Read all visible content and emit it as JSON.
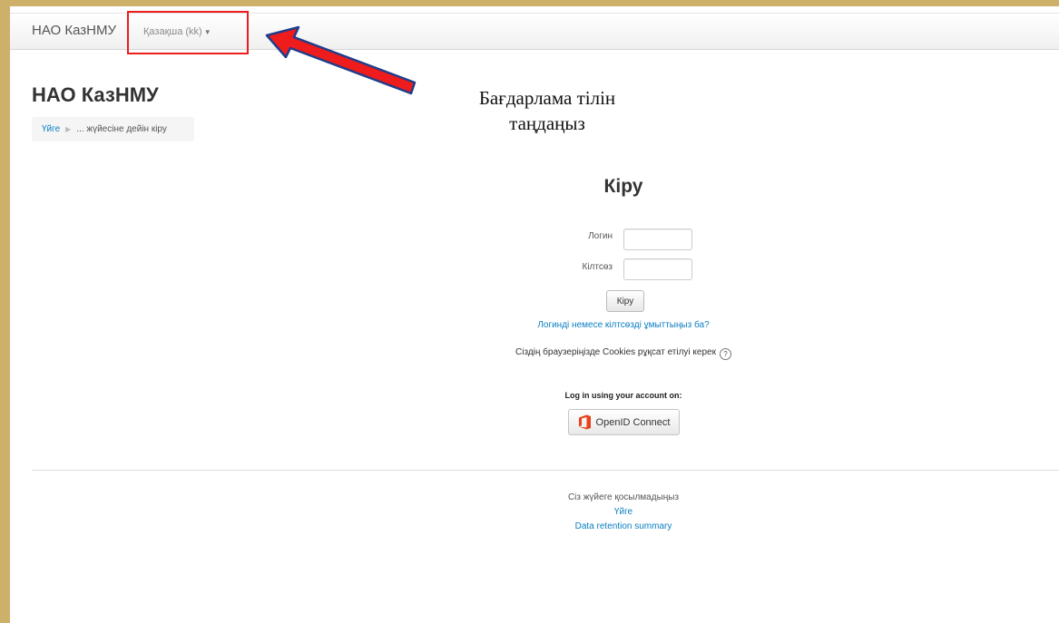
{
  "navbar": {
    "brand": "НАО КазНМУ",
    "language": "Қазақша (kk)"
  },
  "annotation": {
    "line1": "Бағдарлама тілін",
    "line2": "таңдаңыз"
  },
  "page": {
    "title": "НАО КазНМУ"
  },
  "breadcrumb": {
    "home": "Үйге",
    "current": "... жүйесіне дейін кіру"
  },
  "login": {
    "heading": "Кіру",
    "username_label": "Логин",
    "username_value": "",
    "password_label": "Кілтсөз",
    "password_value": "",
    "submit_label": "Кіру",
    "forgot_link": "Логинді немесе кілтсөзді ұмыттыңыз ба?",
    "cookies_notice": "Сіздің браузеріңізде Cookies рұқсат етілуі керек",
    "oauth_label": "Log in using your account on:",
    "openid_label": "OpenID Connect"
  },
  "footer": {
    "status": "Сіз жүйеге қосылмадыңыз",
    "home_link": "Үйге",
    "retention_link": "Data retention summary"
  },
  "colors": {
    "frame": "#cdb06a",
    "link": "#0a7ec2",
    "highlight": "#ee1c1c",
    "arrow_fill": "#ee1c1c",
    "arrow_outline": "#1f3d8a",
    "office_icon": "#e8411b"
  },
  "icons": {
    "caret": "caret-down-icon",
    "help": "help-icon",
    "openid": "office-icon",
    "breadcrumb_separator": "triangle-right-icon"
  }
}
